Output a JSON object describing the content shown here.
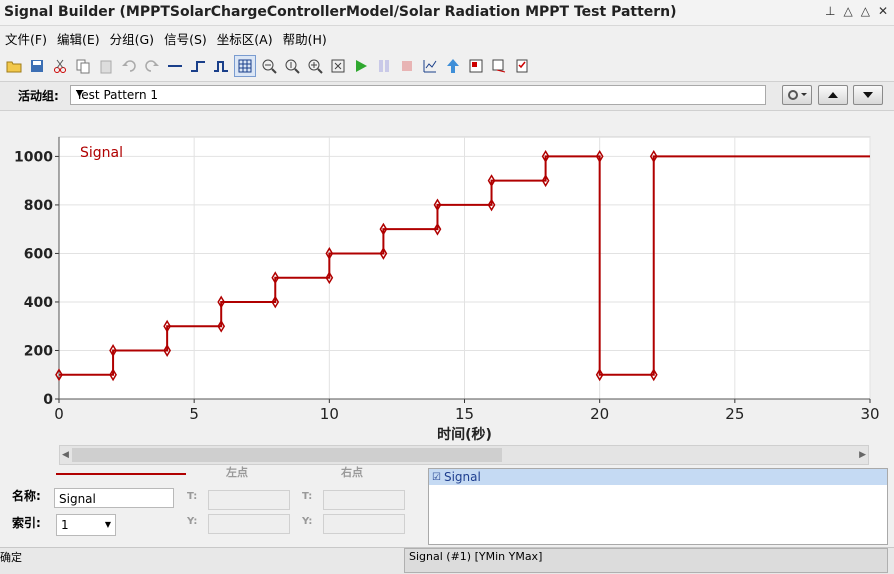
{
  "window": {
    "title": "Signal Builder (MPPTSolarChargeControllerModel/Solar Radiation MPPT Test Pattern)",
    "controls": [
      "⍓",
      "△",
      "△",
      "✕"
    ]
  },
  "menu": [
    "文件(F)",
    "编辑(E)",
    "分组(G)",
    "信号(S)",
    "坐标区(A)",
    "帮助(H)"
  ],
  "toolbar_icons": [
    "open-icon",
    "save-icon",
    "cut-icon",
    "copy-icon",
    "paste-icon",
    "undo-icon",
    "redo-icon",
    "hline-icon",
    "step-icon",
    "pulse-icon",
    "grid-icon",
    "zoom-x-icon",
    "zoom-y-icon",
    "zoom-in-icon",
    "fit-icon",
    "play-icon",
    "pause-icon",
    "stop-icon",
    "data-icon",
    "up-icon",
    "link-icon",
    "export-icon",
    "report-icon"
  ],
  "group": {
    "label": "活动组:",
    "selected": "Test Pattern 1"
  },
  "chart_data": {
    "type": "line",
    "series": [
      {
        "name": "Signal",
        "color": "#b00000",
        "x": [
          0,
          2,
          2,
          4,
          4,
          6,
          6,
          8,
          8,
          10,
          10,
          12,
          12,
          14,
          14,
          16,
          16,
          18,
          18,
          20,
          20,
          22,
          22,
          30
        ],
        "y": [
          100,
          100,
          200,
          200,
          300,
          300,
          400,
          400,
          500,
          500,
          600,
          600,
          700,
          700,
          800,
          800,
          900,
          900,
          1000,
          1000,
          100,
          100,
          1000,
          1000
        ]
      }
    ],
    "xlabel": "时间(秒)",
    "ylabel": "",
    "xlim": [
      0,
      30
    ],
    "ylim": [
      0,
      1080
    ],
    "xticks": [
      0,
      5,
      10,
      15,
      20,
      25,
      30
    ],
    "yticks": [
      0,
      200,
      400,
      600,
      800,
      1000
    ],
    "grid": true,
    "legend": "top-left"
  },
  "editor": {
    "left_point_label": "左点",
    "right_point_label": "右点",
    "name_label": "名称:",
    "name_value": "Signal",
    "index_label": "索引:",
    "index_value": "1",
    "t_label": "T:",
    "y_label": "Y:"
  },
  "signal_list": [
    {
      "label": "Signal",
      "checked": true
    }
  ],
  "status": {
    "left": "确定",
    "right": "Signal (#1)  [YMin YMax]"
  }
}
